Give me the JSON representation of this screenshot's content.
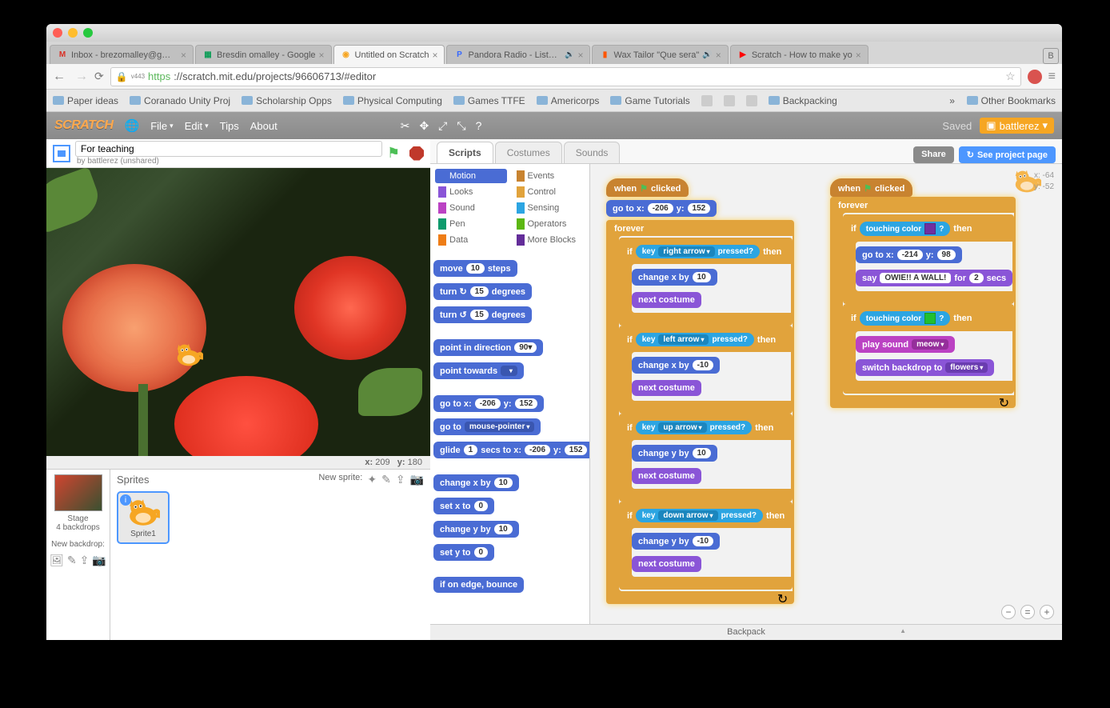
{
  "browser": {
    "tabs": [
      {
        "icon": "M",
        "iconColor": "#d93025",
        "title": "Inbox - brezomalley@gm…"
      },
      {
        "icon": "▦",
        "iconColor": "#0f9d58",
        "title": "Bresdin omalley - Google"
      },
      {
        "icon": "◉",
        "iconColor": "#f6a623",
        "title": "Untitled on Scratch",
        "active": true
      },
      {
        "icon": "P",
        "iconColor": "#3668ff",
        "title": "Pandora Radio - Listen to",
        "audio": true
      },
      {
        "icon": "▮",
        "iconColor": "#ff5500",
        "title": "Wax Tailor \"Que sera\"",
        "audio": true
      },
      {
        "icon": "▶",
        "iconColor": "#ff0000",
        "title": "Scratch - How to make yo"
      }
    ],
    "profile": "B",
    "url_https": "https",
    "url_host": "://scratch.mit.edu",
    "url_path": "/projects/96606713/#editor",
    "url_port_label": "v443",
    "bookmarks": [
      "Paper ideas",
      "Coranado Unity Proj",
      "Scholarship Opps",
      "Physical Computing",
      "Games TTFE",
      "Americorps",
      "Game Tutorials"
    ],
    "bookmark_icons_tail": 3,
    "bookmark_backpacking": "Backpacking",
    "other_bookmarks": "Other Bookmarks",
    "more_arrow": "»"
  },
  "scratch_top": {
    "menus": [
      "File",
      "Edit",
      "Tips",
      "About"
    ],
    "saved": "Saved",
    "user": "battlerez"
  },
  "project": {
    "title": "For teaching",
    "by_prefix": "by ",
    "by_user": "battlerez",
    "status": " (unshared)",
    "coords": {
      "xlabel": "x:",
      "x": "209",
      "ylabel": "y:",
      "y": "180"
    }
  },
  "stage_panel": {
    "stage_label": "Stage",
    "backdrops": "4 backdrops",
    "new_backdrop": "New backdrop:",
    "sprites_label": "Sprites",
    "new_sprite": "New sprite:",
    "sprite1": "Sprite1"
  },
  "tabs": {
    "scripts": "Scripts",
    "costumes": "Costumes",
    "sounds": "Sounds"
  },
  "share": {
    "share": "Share",
    "see": "See project page"
  },
  "categories": [
    {
      "name": "Motion",
      "color": "#4a6cd4",
      "selected": true
    },
    {
      "name": "Events",
      "color": "#c88330"
    },
    {
      "name": "Looks",
      "color": "#8a55d7"
    },
    {
      "name": "Control",
      "color": "#e1a33c"
    },
    {
      "name": "Sound",
      "color": "#bb42c3"
    },
    {
      "name": "Sensing",
      "color": "#2ca5e2"
    },
    {
      "name": "Pen",
      "color": "#0e9a6c"
    },
    {
      "name": "Operators",
      "color": "#5cb712"
    },
    {
      "name": "Data",
      "color": "#ee7d16"
    },
    {
      "name": "More Blocks",
      "color": "#632d99"
    }
  ],
  "palette": {
    "move": "move",
    "move_n": "10",
    "steps": "steps",
    "turn_cw": "turn ↻",
    "turn_ccw": "turn ↺",
    "deg": "degrees",
    "turn_n": "15",
    "point_dir": "point in direction",
    "dir_n": "90▾",
    "point_towards": "point towards",
    "go_to_xy": "go to x:",
    "gx": "-206",
    "y_label": "y:",
    "gy": "152",
    "go_to": "go to",
    "go_to_target": "mouse-pointer",
    "glide": "glide",
    "glide_n": "1",
    "secs_to_x": "secs to x:",
    "change_x": "change x by",
    "cx": "10",
    "set_x": "set x to",
    "sx": "0",
    "change_y": "change y by",
    "cy": "10",
    "set_y": "set y to",
    "sy": "0",
    "edge": "if on edge, bounce"
  },
  "canvas": {
    "sprite_x_label": "x:",
    "sprite_x": "-64",
    "sprite_y_label": "y:",
    "sprite_y": "-52",
    "script1": {
      "when": "when",
      "clicked": "clicked",
      "goto": "go to x:",
      "gx": "-206",
      "yl": "y:",
      "gy": "152",
      "forever": "forever",
      "if": "if",
      "then": "then",
      "key": "key",
      "pressed": "pressed?",
      "keys": [
        "right arrow",
        "left arrow",
        "up arrow",
        "down arrow"
      ],
      "change_x": "change x by",
      "cx1": "10",
      "cx2": "-10",
      "change_y": "change y by",
      "cy1": "10",
      "cy2": "-10",
      "next_costume": "next costume"
    },
    "script2": {
      "when": "when",
      "clicked": "clicked",
      "forever": "forever",
      "if": "if",
      "then": "then",
      "touching": "touching color",
      "q": "?",
      "color1": "#7030a0",
      "color2": "#20c030",
      "goto": "go to x:",
      "gx": "-214",
      "yl": "y:",
      "gy": "98",
      "say": "say",
      "say_msg": "OWIE!! A WALL!",
      "for": "for",
      "secs_n": "2",
      "secs": "secs",
      "play_sound": "play sound",
      "sound": "meow",
      "switch_backdrop": "switch backdrop to",
      "backdrop": "flowers"
    }
  },
  "backpack": "Backpack"
}
